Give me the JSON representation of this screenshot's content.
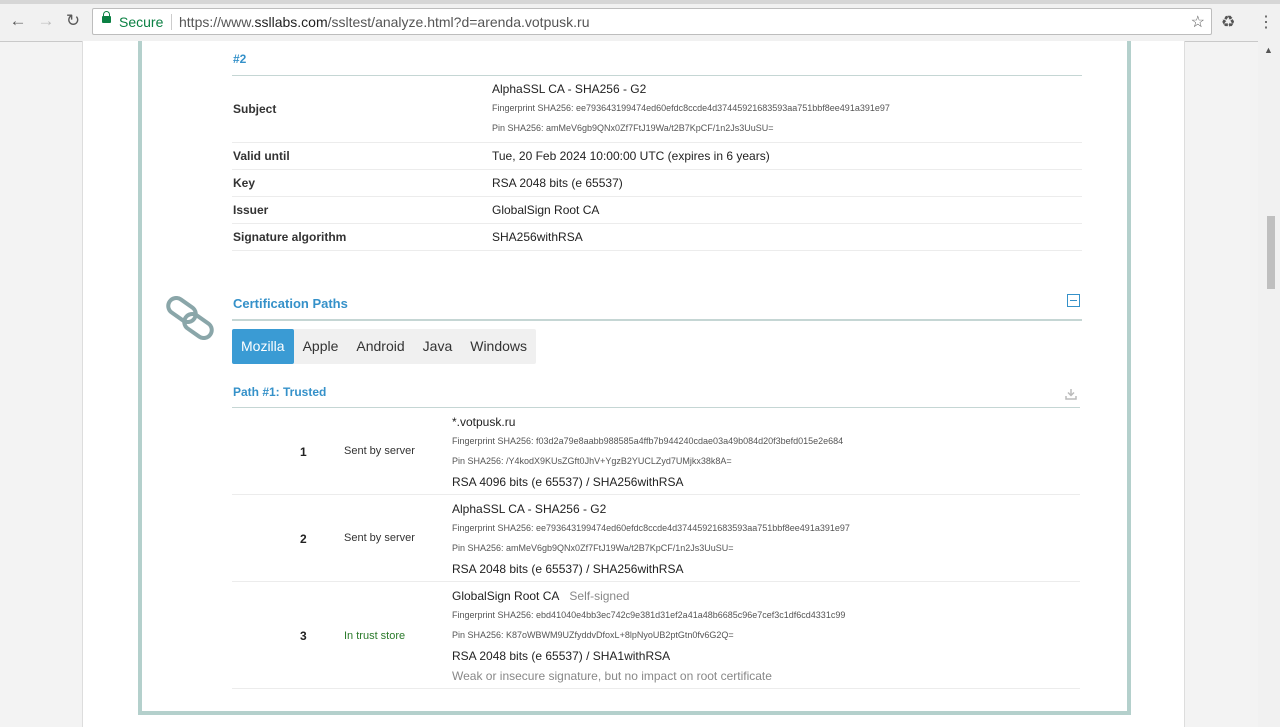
{
  "browser": {
    "secure_label": "Secure",
    "url_prefix": "https://www.",
    "url_host": "ssllabs.com",
    "url_path": "/ssltest/analyze.html?d=arenda.votpusk.ru"
  },
  "cert2": {
    "label": "#2",
    "subject_key": "Subject",
    "subject_value": "AlphaSSL CA - SHA256 - G2",
    "subject_fp": "Fingerprint SHA256: ee793643199474ed60efdc8ccde4d37445921683593aa751bbf8ee491a391e97",
    "subject_pin": "Pin SHA256: amMeV6gb9QNx0Zf7FtJ19Wa/t2B7KpCF/1n2Js3UuSU=",
    "valid_key": "Valid until",
    "valid_value": "Tue, 20 Feb 2024 10:00:00 UTC (expires in 6 years)",
    "key_key": "Key",
    "key_value": "RSA 2048 bits (e 65537)",
    "issuer_key": "Issuer",
    "issuer_value": "GlobalSign Root CA",
    "sig_key": "Signature algorithm",
    "sig_value": "SHA256withRSA"
  },
  "paths": {
    "title": "Certification Paths",
    "tabs": [
      "Mozilla",
      "Apple",
      "Android",
      "Java",
      "Windows"
    ],
    "active_tab": "Mozilla",
    "path_title": "Path #1: Trusted",
    "rows": [
      {
        "num": "1",
        "status": "Sent by server",
        "name": "*.votpusk.ru",
        "fp": "Fingerprint SHA256: f03d2a79e8aabb988585a4ffb7b944240cdae03a49b084d20f3befd015e2e684",
        "pin": "Pin SHA256: /Y4kodX9KUsZGft0JhV+YgzB2YUCLZyd7UMjkx38k8A=",
        "key": "RSA 4096 bits (e 65537) / SHA256withRSA"
      },
      {
        "num": "2",
        "status": "Sent by server",
        "name": "AlphaSSL CA - SHA256 - G2",
        "fp": "Fingerprint SHA256: ee793643199474ed60efdc8ccde4d37445921683593aa751bbf8ee491a391e97",
        "pin": "Pin SHA256: amMeV6gb9QNx0Zf7FtJ19Wa/t2B7KpCF/1n2Js3UuSU=",
        "key": "RSA 2048 bits (e 65537) / SHA256withRSA"
      },
      {
        "num": "3",
        "status": "In trust store",
        "name": "GlobalSign Root CA",
        "note": "Self-signed",
        "fp": "Fingerprint SHA256: ebd41040e4bb3ec742c9e381d31ef2a41a48b6685c96e7cef3c1df6cd4331c99",
        "pin": "Pin SHA256: K87oWBWM9UZfyddvDfoxL+8lpNyoUB2ptGtn0fv6G2Q=",
        "key": "RSA 2048 bits (e 65537) / SHA1withRSA",
        "warning": "Weak or insecure signature, but no impact on root certificate"
      }
    ]
  }
}
